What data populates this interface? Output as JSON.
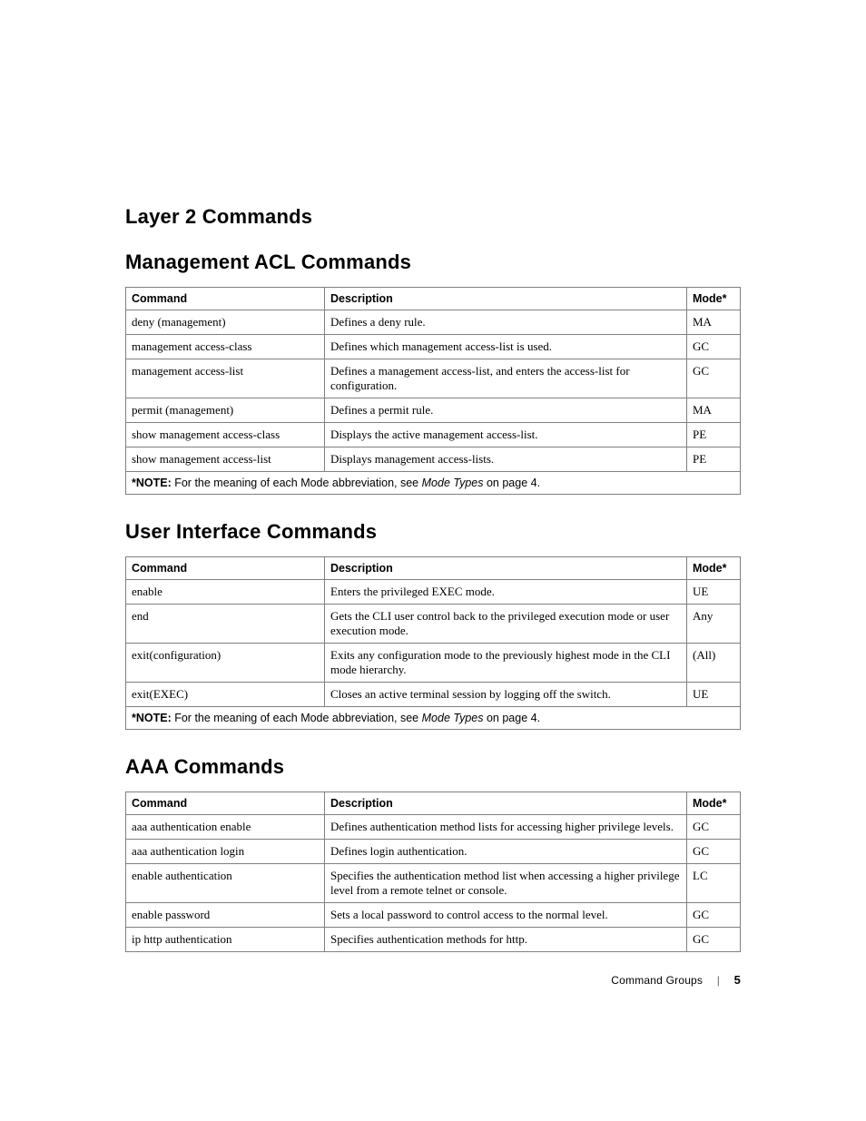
{
  "headings": {
    "main": "Layer 2 Commands",
    "section1": "Management ACL Commands",
    "section2": "User Interface Commands",
    "section3": "AAA Commands"
  },
  "table_headers": {
    "command": "Command",
    "description": "Description",
    "mode": "Mode*"
  },
  "note": {
    "prefix": "*NOTE:",
    "mid": " For the meaning of each Mode abbreviation, see ",
    "italic": "Mode Types",
    "suffix": " on page 4."
  },
  "tables": {
    "mgmt_acl": {
      "rows": [
        {
          "command": "deny (management)",
          "description": "Defines a deny rule.",
          "mode": "MA"
        },
        {
          "command": "management access-class",
          "description": "Defines which management access-list is used.",
          "mode": "GC"
        },
        {
          "command": "management access-list",
          "description": "Defines a management access-list, and enters the access-list for configuration.",
          "mode": "GC"
        },
        {
          "command": "permit (management)",
          "description": "Defines a permit rule.",
          "mode": "MA"
        },
        {
          "command": "show management access-class",
          "description": "Displays the active management access-list.",
          "mode": "PE"
        },
        {
          "command": "show management access-list",
          "description": "Displays management access-lists.",
          "mode": "PE"
        }
      ]
    },
    "ui": {
      "rows": [
        {
          "command": "enable",
          "description": "Enters the privileged EXEC mode.",
          "mode": "UE"
        },
        {
          "command": "end",
          "description": "Gets the CLI user control back to the privileged execution mode or user execution mode.",
          "mode": "Any"
        },
        {
          "command": "exit(configuration)",
          "description": "Exits any configuration mode to the previously highest mode in the CLI mode hierarchy.",
          "mode": "(All)"
        },
        {
          "command": "exit(EXEC)",
          "description": "Closes an active terminal session by logging off the switch.",
          "mode": "UE"
        }
      ]
    },
    "aaa": {
      "rows": [
        {
          "command": "aaa authentication enable",
          "description": "Defines authentication method lists for accessing higher privilege levels.",
          "mode": "GC"
        },
        {
          "command": "aaa authentication login",
          "description": "Defines login authentication.",
          "mode": "GC"
        },
        {
          "command": "enable authentication",
          "description": "Specifies the authentication method list when accessing a higher privilege level from a remote telnet or console.",
          "mode": "LC"
        },
        {
          "command": "enable password",
          "description": "Sets a local password to control access to the normal level.",
          "mode": "GC"
        },
        {
          "command": "ip http authentication",
          "description": "Specifies authentication methods for http.",
          "mode": "GC"
        }
      ]
    }
  },
  "footer": {
    "section": "Command Groups",
    "page": "5"
  },
  "chart_data": {
    "type": "table",
    "tables": [
      {
        "title": "Management ACL Commands",
        "columns": [
          "Command",
          "Description",
          "Mode*"
        ],
        "rows": [
          [
            "deny (management)",
            "Defines a deny rule.",
            "MA"
          ],
          [
            "management access-class",
            "Defines which management access-list is used.",
            "GC"
          ],
          [
            "management access-list",
            "Defines a management access-list, and enters the access-list for configuration.",
            "GC"
          ],
          [
            "permit (management)",
            "Defines a permit rule.",
            "MA"
          ],
          [
            "show management access-class",
            "Displays the active management access-list.",
            "PE"
          ],
          [
            "show management access-list",
            "Displays management access-lists.",
            "PE"
          ]
        ],
        "note": "*NOTE: For the meaning of each Mode abbreviation, see Mode Types on page 4."
      },
      {
        "title": "User Interface Commands",
        "columns": [
          "Command",
          "Description",
          "Mode*"
        ],
        "rows": [
          [
            "enable",
            "Enters the privileged EXEC mode.",
            "UE"
          ],
          [
            "end",
            "Gets the CLI user control back to the privileged execution mode or user execution mode.",
            "Any"
          ],
          [
            "exit(configuration)",
            "Exits any configuration mode to the previously highest mode in the CLI mode hierarchy.",
            "(All)"
          ],
          [
            "exit(EXEC)",
            "Closes an active terminal session by logging off the switch.",
            "UE"
          ]
        ],
        "note": "*NOTE: For the meaning of each Mode abbreviation, see Mode Types on page 4."
      },
      {
        "title": "AAA Commands",
        "columns": [
          "Command",
          "Description",
          "Mode*"
        ],
        "rows": [
          [
            "aaa authentication enable",
            "Defines authentication method lists for accessing higher privilege levels.",
            "GC"
          ],
          [
            "aaa authentication login",
            "Defines login authentication.",
            "GC"
          ],
          [
            "enable authentication",
            "Specifies the authentication method list when accessing a higher privilege level from a remote telnet or console.",
            "LC"
          ],
          [
            "enable password",
            "Sets a local password to control access to the normal level.",
            "GC"
          ],
          [
            "ip http authentication",
            "Specifies authentication methods for http.",
            "GC"
          ]
        ]
      }
    ]
  }
}
